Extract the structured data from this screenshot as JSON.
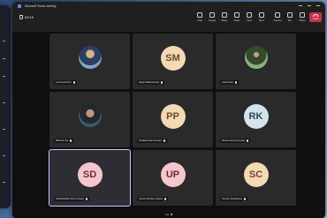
{
  "window": {
    "title": "Microsoft Teams meeting"
  },
  "meeting": {
    "timer": "00:19"
  },
  "toolbar": {
    "buttons": [
      {
        "label": "Chat",
        "icon": "chat-icon"
      },
      {
        "label": "People",
        "icon": "people-icon"
      },
      {
        "label": "Raise",
        "icon": "raise-hand-icon"
      },
      {
        "label": "React",
        "icon": "react-icon"
      },
      {
        "label": "View",
        "icon": "view-icon"
      },
      {
        "label": "More",
        "icon": "more-icon"
      },
      {
        "label": "Camera",
        "icon": "camera-icon"
      },
      {
        "label": "Mic",
        "icon": "mic-icon"
      },
      {
        "label": "Share",
        "icon": "share-icon"
      }
    ],
    "leave_label": "Leave"
  },
  "participants": [
    {
      "name": "Lal Chand Dixit",
      "initials": "",
      "type": "photo",
      "color": "#6a8cb0"
    },
    {
      "name": "Sagar Mittal (Guest)",
      "initials": "SM",
      "type": "initials",
      "color": "#f3d9b4"
    },
    {
      "name": "Anand Rao",
      "initials": "",
      "type": "photo",
      "color": "#4a6a3a"
    },
    {
      "name": "Mahesh Jha",
      "initials": "",
      "type": "photo",
      "color": "#2d4c5c"
    },
    {
      "name": "Pradeep Patel (Guest)",
      "initials": "PP",
      "type": "initials",
      "color": "#f3d9b4"
    },
    {
      "name": "Raman Kumar (Guest)",
      "initials": "RK",
      "type": "initials",
      "color": "#d5e3ec"
    },
    {
      "name": "SUDHANSHU DAS (Guest)",
      "initials": "SD",
      "type": "initials",
      "color": "#f4c7cc",
      "active": true
    },
    {
      "name": "Umesh Pandey (Guest)",
      "initials": "UP",
      "type": "initials",
      "color": "#f4c7cc"
    },
    {
      "name": "Suresh Chakraborty",
      "initials": "SC",
      "type": "initials",
      "color": "#f3d9b4"
    }
  ],
  "pager": {
    "text": "1/2"
  },
  "colors": {
    "leave": "#c4314b",
    "background": "#121212"
  }
}
